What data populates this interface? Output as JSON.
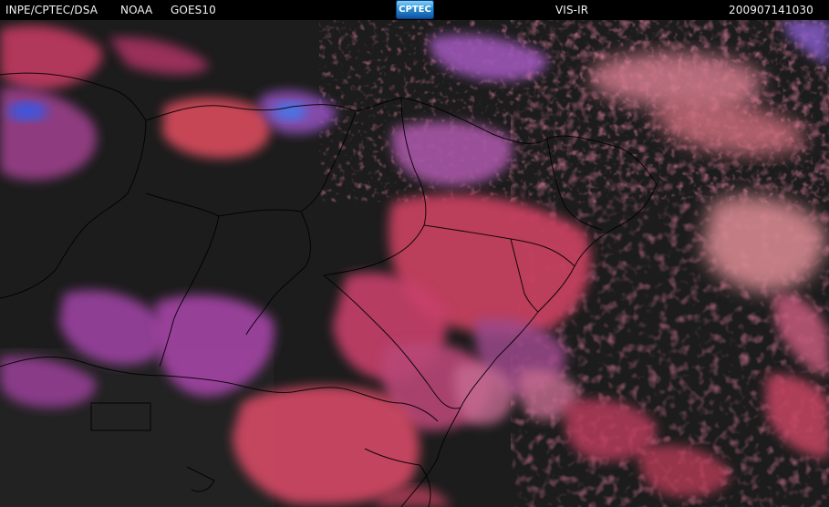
{
  "header": {
    "source": "INPE/CPTEC/DSA",
    "agency": "NOAA",
    "satellite": "GOES10",
    "logo_text": "CPTEC",
    "product": "VIS-IR",
    "timestamp": "200907141030"
  },
  "map": {
    "colors": {
      "background": "#1b1b1b",
      "cloud_warm": "#c83c5a",
      "cloud_cool": "#a03c8c",
      "cloud_cold": "#3c5ae6",
      "cloud_light": "#d98aa0",
      "border_line": "#000000"
    }
  }
}
